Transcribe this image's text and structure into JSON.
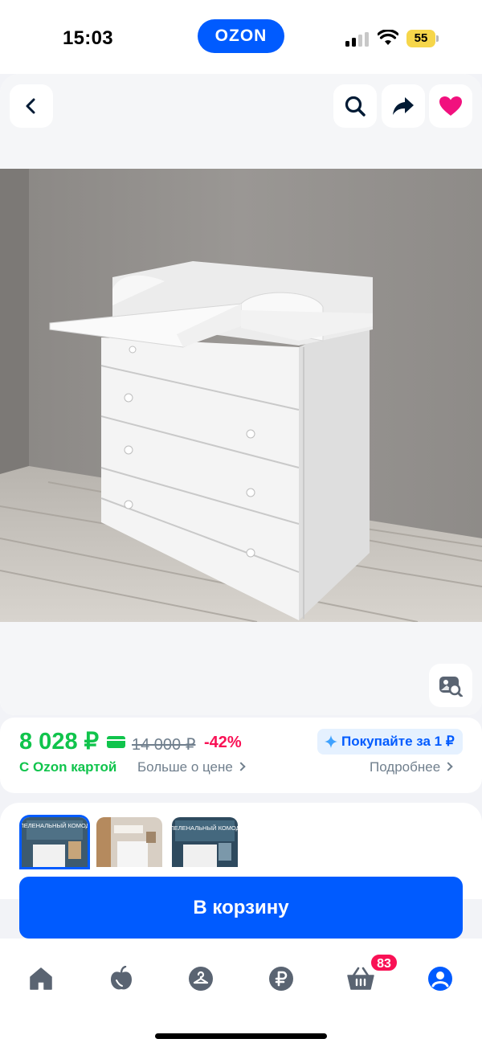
{
  "status_bar": {
    "time": "15:03",
    "brand": "OZON",
    "battery": "55"
  },
  "toolbar": {
    "icons": [
      "back-icon",
      "search-icon",
      "share-icon",
      "heart-icon"
    ],
    "favorite_color": "#f1117e"
  },
  "image_search": {
    "icon": "image-search-icon"
  },
  "price": {
    "current": "8 028 ₽",
    "old": "14 000 ₽",
    "discount": "-42%",
    "card_label": "С Ozon картой",
    "more_label": "Больше о цене",
    "promo": "Покупайте за 1 ₽",
    "details_label": "Подробнее"
  },
  "gallery": {
    "thumbnails": [
      {
        "text": "ПЕЛЕНАЛЬНЫЙ КОМОД",
        "selected": true
      },
      {
        "text": "",
        "selected": false
      },
      {
        "text": "ПЕЛЕНАЛЬНЫЙ КОМОД",
        "selected": false
      }
    ]
  },
  "cta": {
    "label": "В корзину"
  },
  "nav": {
    "items": [
      "home-icon",
      "fresh-icon",
      "catalog-icon",
      "finance-icon",
      "cart-icon",
      "profile-icon"
    ],
    "cart_badge": "83",
    "active_color": "#005bff"
  },
  "colors": {
    "accent": "#005bff",
    "price_green": "#10c44c",
    "discount_red": "#f91155"
  }
}
